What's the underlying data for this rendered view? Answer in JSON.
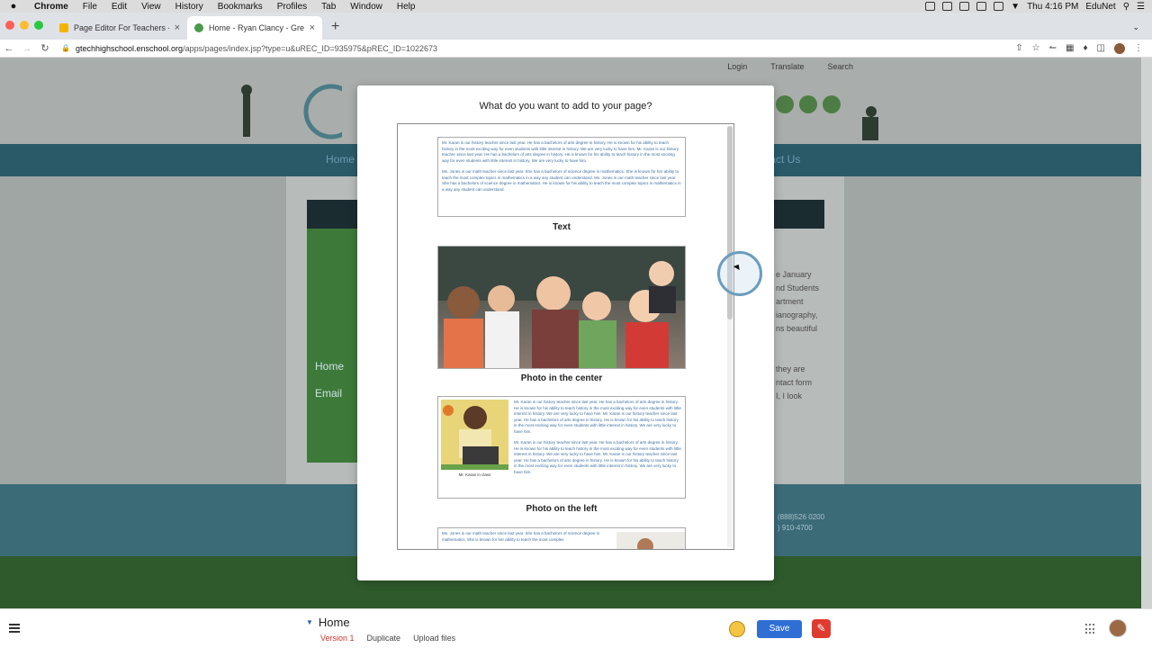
{
  "menubar": {
    "apple": "",
    "app": "Chrome",
    "items": [
      "File",
      "Edit",
      "View",
      "History",
      "Bookmarks",
      "Profiles",
      "Tab",
      "Window",
      "Help"
    ],
    "clock": "Thu 4:16 PM",
    "user": "EduNet"
  },
  "tabs": [
    {
      "title": "Page Editor For Teachers - Go",
      "favicon_color": "#f2b400"
    },
    {
      "title": "Home - Ryan Clancy - GreenT",
      "favicon_color": "#4a9a4a"
    }
  ],
  "address": {
    "domain": "gtechhighschool.enschool.org",
    "path": "/apps/pages/index.jsp?type=u&uREC_ID=935975&pREC_ID=1022673"
  },
  "site": {
    "top_links": [
      "Login",
      "Translate",
      "Search"
    ],
    "nav_left": "Home",
    "nav_right": "tact Us",
    "side_links": [
      "Home",
      "Email"
    ],
    "body_lines": [
      "e January",
      "nd Students",
      "artment",
      "",
      "ianography,",
      "ns beautiful",
      "",
      "",
      "they are",
      "ntact form",
      "I, I look"
    ],
    "phone_lines": [
      "(888)526 0200",
      ") 910-4700"
    ]
  },
  "modal": {
    "title": "What do you want to add to your page?",
    "options": [
      {
        "label": "Text"
      },
      {
        "label": "Photo in the center"
      },
      {
        "label": "Photo on the left",
        "caption": "Mr. Karan in class"
      }
    ],
    "sample_text_1": "Mr. Karan is our history teacher since last year. He has a bachelors of arts degree in history. He is known for his ability to teach history in the most exciting way for even students with little interest in history. We are very lucky to have him. Mr. Karan is our history teacher since last year. He has a bachelors of arts degree in history. He is known for his ability to teach history in the most exciting way for even students with little interest in history. We are very lucky to have him.",
    "sample_text_2": "Ms. Jones is our math teacher since last year. She has a bachelors of science degree in mathematics. She is known for her ability to teach the most complex topics in mathematics in a way any student can understand. Ms. Jones is our math teacher since last year. She has a bachelors of science degree in mathematics. He is known for his ability to teach the most complex topics in mathematics in a way any student can understand.",
    "sample_text_3": "Ms. Jones is our math teacher since last year. She has a bachelors of science degree in mathematics. She is known for her ability to teach the most complex"
  },
  "editor": {
    "page_name": "Home",
    "version": "Version 1",
    "duplicate": "Duplicate",
    "upload": "Upload files",
    "save": "Save"
  },
  "colors": {
    "save": "#2f6fd4",
    "version": "#d0342c",
    "link_blue": "#3d6fa0"
  }
}
